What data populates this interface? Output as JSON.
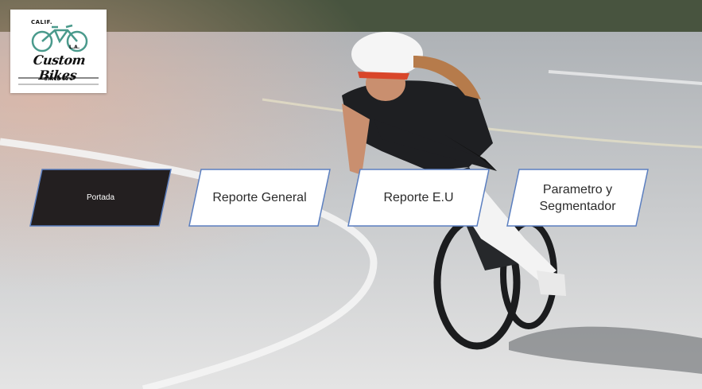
{
  "logo": {
    "top_text": "CALIF.",
    "sub_text": "L.A.",
    "brand": "Custom Bikes",
    "since": "SINCE 60's"
  },
  "nav": {
    "portada": "Portada",
    "reporte_general": "Reporte General",
    "reporte_eu": "Reporte E.U",
    "parametro_line1": "Parametro y",
    "parametro_line2": "Segmentador"
  },
  "colors": {
    "active_button": "#231f20",
    "button_fill": "#ffffff",
    "button_border": "#5b7fc0",
    "logo_bike": "#4a9a8c"
  }
}
